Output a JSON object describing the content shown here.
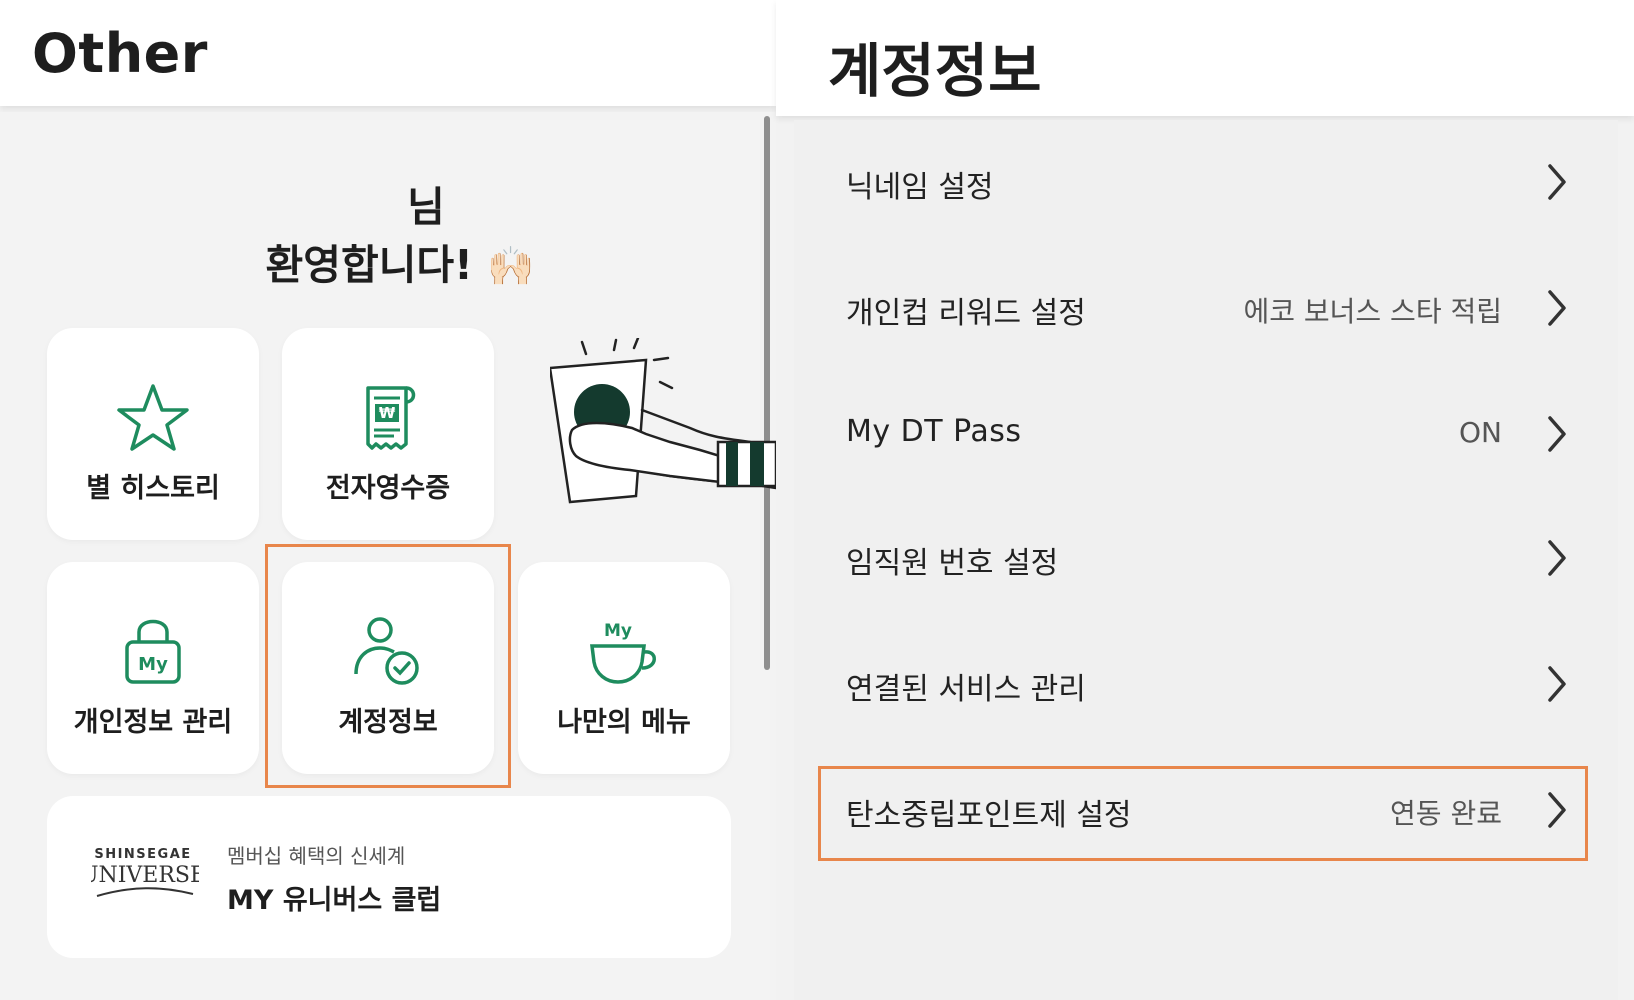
{
  "left": {
    "title": "Other",
    "welcome": {
      "line1": "님",
      "line2": "환영합니다!",
      "emoji": "🙌🏻"
    },
    "tiles": [
      {
        "label": "별 히스토리",
        "icon": "star-icon"
      },
      {
        "label": "전자영수증",
        "icon": "receipt-icon"
      },
      {
        "label": "개인정보 관리",
        "icon": "lock-icon"
      },
      {
        "label": "계정정보",
        "icon": "user-check-icon"
      },
      {
        "label": "나만의 메뉴",
        "icon": "my-cup-icon"
      }
    ],
    "universe": {
      "logo_top": "SHINSEGAE",
      "logo_bottom": "UNIVERSE",
      "subtitle": "멤버십 혜택의 신세계",
      "title": "MY 유니버스 클럽"
    },
    "icon_text": {
      "won": "₩",
      "my": "My"
    }
  },
  "right": {
    "title": "계정정보",
    "rows": [
      {
        "label": "닉네임 설정",
        "value": ""
      },
      {
        "label": "개인컵 리워드 설정",
        "value": "에코 보너스 스타 적립"
      },
      {
        "label": "My DT Pass",
        "value": "ON"
      },
      {
        "label": "임직원 번호 설정",
        "value": ""
      },
      {
        "label": "연결된 서비스 관리",
        "value": ""
      },
      {
        "label": "탄소중립포인트제 설정",
        "value": "연동 완료"
      }
    ]
  },
  "colors": {
    "accent_green": "#1e8c5e",
    "highlight_orange": "#e8864b",
    "tile_bg": "#ffffff",
    "page_bg": "#f2f2f2"
  }
}
